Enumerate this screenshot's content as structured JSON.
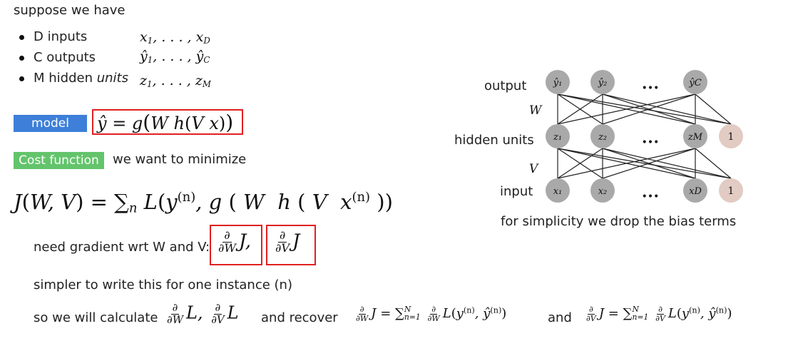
{
  "intro": "suppose we have",
  "items": [
    {
      "label": "D inputs",
      "math": "x₁, . . . , x_D"
    },
    {
      "label": "C outputs",
      "math": "ŷ₁, . . . , ŷ_C"
    },
    {
      "label_pre": "M hidden ",
      "label_em": "units",
      "math": "z₁, . . . , z_M"
    }
  ],
  "model": {
    "tag": "model",
    "tag_color": "#3d7fd9",
    "equation": "ŷ = g(W h(V x))"
  },
  "cost": {
    "tag": "Cost function",
    "tag_color": "#63c46b",
    "text": "we want to minimize"
  },
  "objective": "J(W, V) = ∑n L(y(n), g ( W h ( V x(n) ))",
  "gradient": {
    "text": "need gradient wrt W and V:",
    "term1": "∂/∂W J,",
    "term2": "∂/∂V J"
  },
  "simpler": "simpler to write this for one instance (n)",
  "calculate": {
    "pre": "so we will calculate",
    "terms": "∂/∂W L, ∂/∂V L",
    "mid": "and recover",
    "eq1": "∂/∂W J = ∑_{n=1}^{N} ∂/∂W L(y(n), ŷ(n))",
    "and": "and",
    "eq2": "∂/∂V J = ∑_{n=1}^{N} ∂/∂V L(y(n), ŷ(n))"
  },
  "diagram": {
    "layer_labels": [
      "output",
      "hidden units",
      "input"
    ],
    "weight_labels": [
      "W",
      "V"
    ],
    "output_nodes": [
      "ŷ₁",
      "ŷ₂",
      "ŷC"
    ],
    "hidden_nodes": [
      "z₁",
      "z₂",
      "zM",
      "1"
    ],
    "input_nodes": [
      "x₁",
      "x₂",
      "xD",
      "1"
    ],
    "ellipsis": "•••",
    "caption": "for simplicity we drop the bias terms",
    "node_color": "#a9a9a9",
    "bias_color": "#e2cbc3"
  }
}
